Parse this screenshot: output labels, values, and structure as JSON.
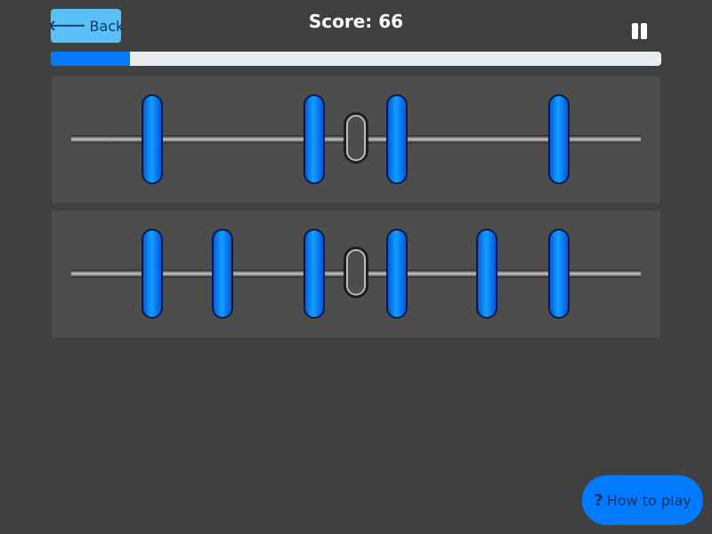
{
  "header": {
    "back_label": "Back",
    "back_icon": "arrow-left-icon",
    "score_text": "Score: 66",
    "pause_icon": "pause-icon"
  },
  "progress": {
    "fraction": 0.13
  },
  "rows": [
    {
      "beads": [
        1,
        3,
        4,
        6
      ],
      "slots": 7,
      "link_after": 3
    },
    {
      "beads": [
        1,
        2,
        3,
        4,
        5,
        6
      ],
      "slots": 7,
      "link_after": 3
    }
  ],
  "footer": {
    "how_to_play_label": "How to play",
    "help_icon": "question-icon"
  },
  "colors": {
    "background": "#404040",
    "panel": "#4d4d4d",
    "bead": "#0a84ff",
    "progress_fill": "#007bff",
    "back_button": "#5bc0f8"
  }
}
